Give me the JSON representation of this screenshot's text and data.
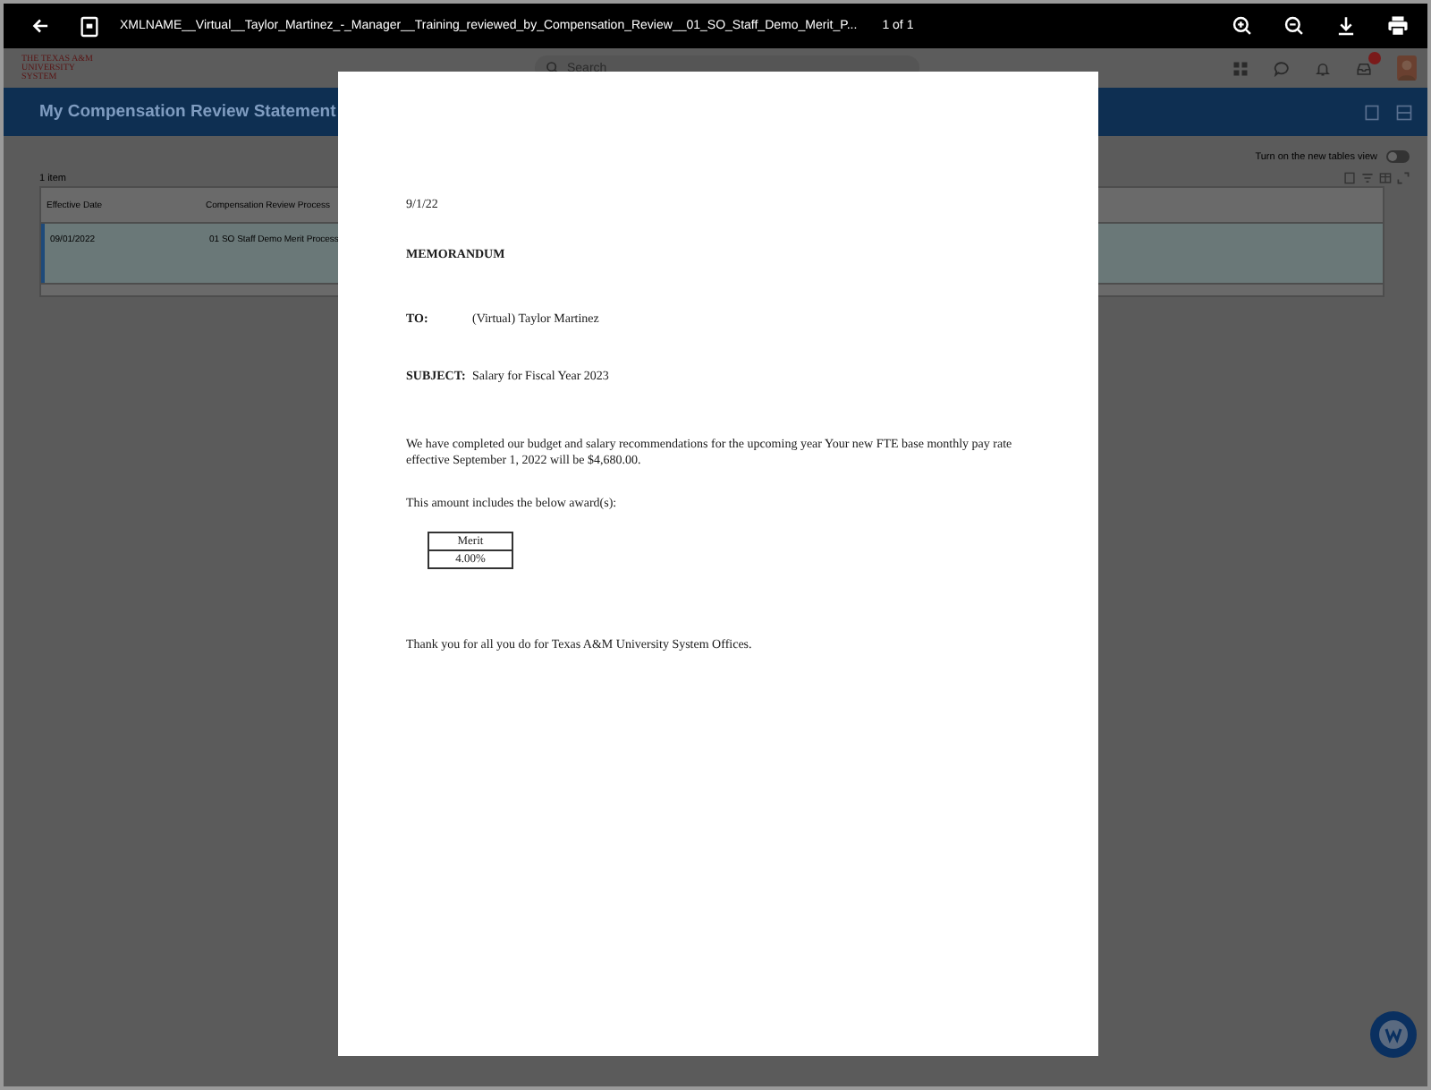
{
  "viewer_bar": {
    "filename": "XMLNAME__Virtual__Taylor_Martinez_-_Manager__Training_reviewed_by_Compensation_Review__01_SO_Staff_Demo_Merit_P...",
    "page_count": "1 of 1"
  },
  "app_header": {
    "logo": "THE TEXAS A&M UNIVERSITY SYSTEM",
    "search": {
      "placeholder": "Search"
    },
    "inbox_badge": true
  },
  "page_title": "My Compensation Review Statement",
  "tables_toggle": {
    "label": "Turn on the new tables view",
    "on": false
  },
  "item_count": "1 item",
  "table": {
    "columns": [
      "Effective Date",
      "Compensation Review Process"
    ],
    "rows": [
      {
        "cells": [
          "09/01/2022",
          "01 SO Staff Demo Merit Process"
        ],
        "selected": true
      }
    ]
  },
  "document": {
    "date": "9/1/22",
    "heading": "MEMORANDUM",
    "fields": [
      {
        "label": "TO:",
        "value": "(Virtual) Taylor Martinez"
      },
      {
        "label": "SUBJECT:",
        "value": "Salary for Fiscal Year 2023"
      }
    ],
    "body": "We have completed our budget and salary recommendations for the upcoming year Your new FTE base monthly pay rate effective September 1, 2022 will be $4,680.00.",
    "award_intro": "This amount includes the below award(s):",
    "award_table": {
      "header": "Merit",
      "value": "4.00%"
    },
    "closing": "Thank you for all you do for Texas A&M University System Offices."
  }
}
